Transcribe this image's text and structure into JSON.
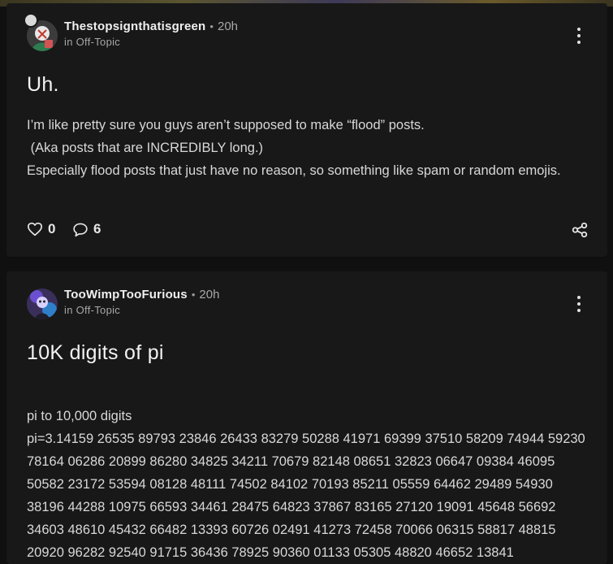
{
  "posts": [
    {
      "author": "Thestopsignthatisgreen",
      "time": "20h",
      "community": "in Off-Topic",
      "title": "Uh.",
      "body": [
        "I’m like pretty sure you guys aren’t supposed to make “flood” posts.",
        " (Aka posts that are INCREDIBLY long.)",
        "Especially flood posts that just have no reason, so something like spam or random emojis."
      ],
      "likes": "0",
      "comments": "6"
    },
    {
      "author": "TooWimpTooFurious",
      "time": "20h",
      "community": "in Off-Topic",
      "title": "10K digits of pi",
      "body": [
        "pi to 10,000 digits",
        "pi=3.14159 26535 89793 23846 26433 83279 50288 41971 69399 37510 58209 74944 59230 78164 06286 20899 86280 34825 34211 70679 82148 08651 32823 06647 09384 46095 50582 23172 53594 08128 48111 74502 84102 70193 85211 05559 64462 29489 54930 38196 44288 10975 66593 34461 28475 64823 37867 83165 27120 19091 45648 56692 34603 48610 45432 66482 13393 60726 02491 41273 72458 70066 06315 58817 48815 20920 96282 92540 91715 36436 78925 90360 01133 05305 48820 46652 13841"
      ]
    }
  ],
  "colors": {
    "background": "#101010",
    "card": "#181818",
    "text": "#e6e6e6",
    "muted": "#a8a8a8"
  },
  "icons": [
    "more-vertical-icon",
    "heart-icon",
    "comment-icon",
    "share-icon"
  ]
}
